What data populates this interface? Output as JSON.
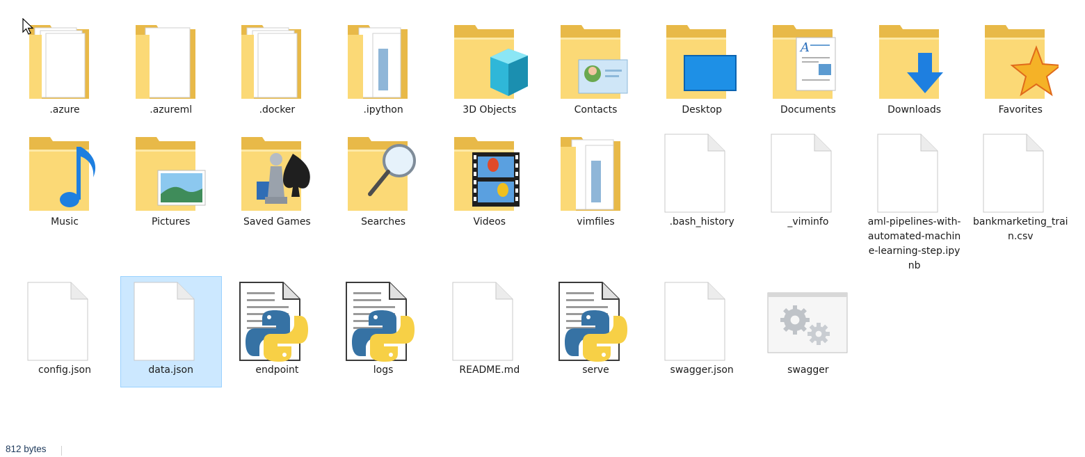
{
  "items": [
    {
      "label": ".azure",
      "icon": "folder-docs-icon",
      "selected": false
    },
    {
      "label": ".azureml",
      "icon": "folder-doc-icon",
      "selected": false
    },
    {
      "label": ".docker",
      "icon": "folder-docs-icon",
      "selected": false
    },
    {
      "label": ".ipython",
      "icon": "folder-image-icon",
      "selected": false
    },
    {
      "label": "3D Objects",
      "icon": "folder-3d-objects-icon",
      "selected": false
    },
    {
      "label": "Contacts",
      "icon": "folder-contacts-icon",
      "selected": false
    },
    {
      "label": "Desktop",
      "icon": "folder-desktop-icon",
      "selected": false
    },
    {
      "label": "Documents",
      "icon": "folder-documents-icon",
      "selected": false
    },
    {
      "label": "Downloads",
      "icon": "folder-downloads-icon",
      "selected": false
    },
    {
      "label": "Favorites",
      "icon": "folder-favorites-icon",
      "selected": false
    },
    {
      "label": "Music",
      "icon": "folder-music-icon",
      "selected": false
    },
    {
      "label": "Pictures",
      "icon": "folder-pictures-icon",
      "selected": false
    },
    {
      "label": "Saved Games",
      "icon": "folder-saved-games-icon",
      "selected": false
    },
    {
      "label": "Searches",
      "icon": "folder-searches-icon",
      "selected": false
    },
    {
      "label": "Videos",
      "icon": "folder-videos-icon",
      "selected": false
    },
    {
      "label": "vimfiles",
      "icon": "folder-image-icon",
      "selected": false
    },
    {
      "label": ".bash_history",
      "icon": "blank-file-icon",
      "selected": false
    },
    {
      "label": "_viminfo",
      "icon": "blank-file-icon",
      "selected": false
    },
    {
      "label": "aml-pipelines-with-automated-machine-learning-step.ipynb",
      "icon": "blank-file-icon",
      "selected": false
    },
    {
      "label": "bankmarketing_train.csv",
      "icon": "blank-file-icon",
      "selected": false
    },
    {
      "label": "config.json",
      "icon": "blank-file-icon",
      "selected": false
    },
    {
      "label": "data.json",
      "icon": "blank-file-icon",
      "selected": true
    },
    {
      "label": "endpoint",
      "icon": "python-file-icon",
      "selected": false
    },
    {
      "label": "logs",
      "icon": "python-file-icon",
      "selected": false
    },
    {
      "label": "README.md",
      "icon": "blank-file-icon",
      "selected": false
    },
    {
      "label": "serve",
      "icon": "python-file-icon",
      "selected": false
    },
    {
      "label": "swagger.json",
      "icon": "blank-file-icon",
      "selected": false
    },
    {
      "label": "swagger",
      "icon": "executable-gears-icon",
      "selected": false
    }
  ],
  "status_bar": {
    "text": "812 bytes"
  },
  "colors": {
    "selection": "#cce8ff",
    "selection_border": "#99d1ff",
    "folder": "#f8d775"
  }
}
